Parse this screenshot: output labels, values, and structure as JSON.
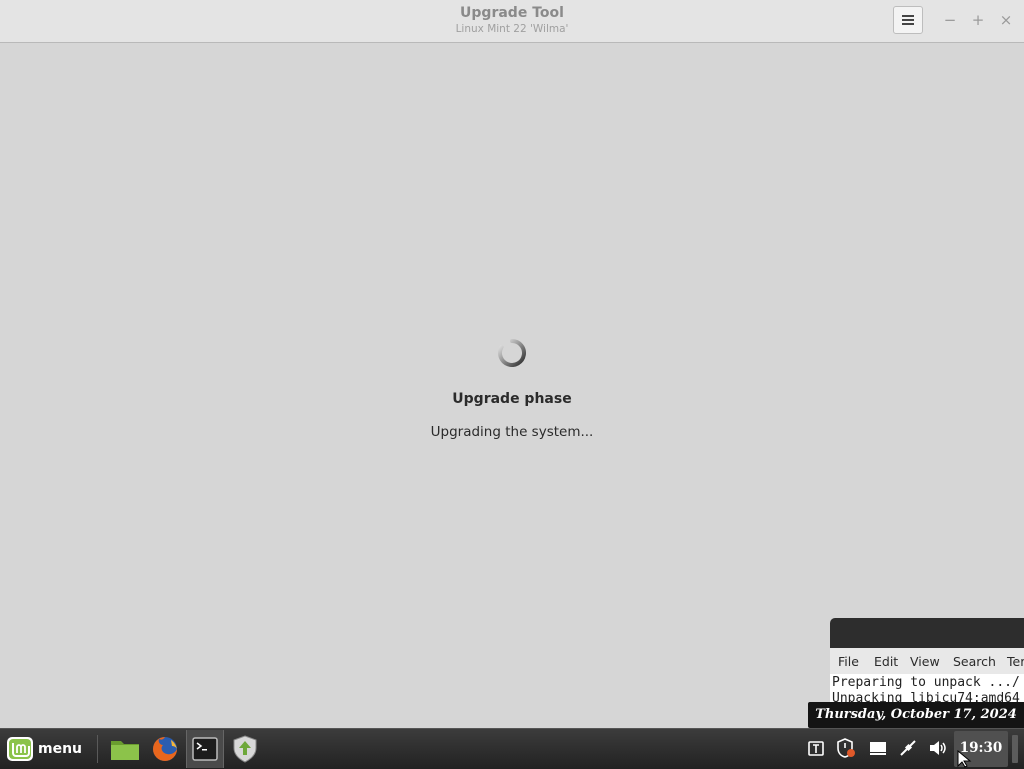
{
  "window": {
    "title": "Upgrade Tool",
    "subtitle": "Linux Mint 22 'Wilma'",
    "menu_icon": "hamburger-menu-icon",
    "minimize_glyph": "−",
    "maximize_glyph": "+",
    "close_glyph": "×"
  },
  "main": {
    "spinner_icon": "loading-spinner-icon",
    "phase_title": "Upgrade phase",
    "phase_status": "Upgrading the system..."
  },
  "terminal": {
    "menu": [
      "File",
      "Edit",
      "View",
      "Search",
      "Ter"
    ],
    "lines": [
      "Preparing to unpack .../",
      "Unpacking libicu74:amd64"
    ]
  },
  "tooltip": {
    "date": "Thursday, October 17, 2024"
  },
  "taskbar": {
    "menu_label": "menu",
    "launchers": [
      "files-icon",
      "firefox-icon",
      "terminal-icon",
      "update-manager-icon"
    ],
    "tray": [
      "keyboard-layout-icon",
      "update-shield-icon",
      "display-icon",
      "network-icon",
      "volume-icon"
    ],
    "clock": "19:30"
  },
  "colors": {
    "window_bg": "#d6d6d6",
    "titlebar_bg": "#e4e4e4",
    "taskbar_bg": "#2c2c2c",
    "mint_green": "#8bc34a"
  }
}
